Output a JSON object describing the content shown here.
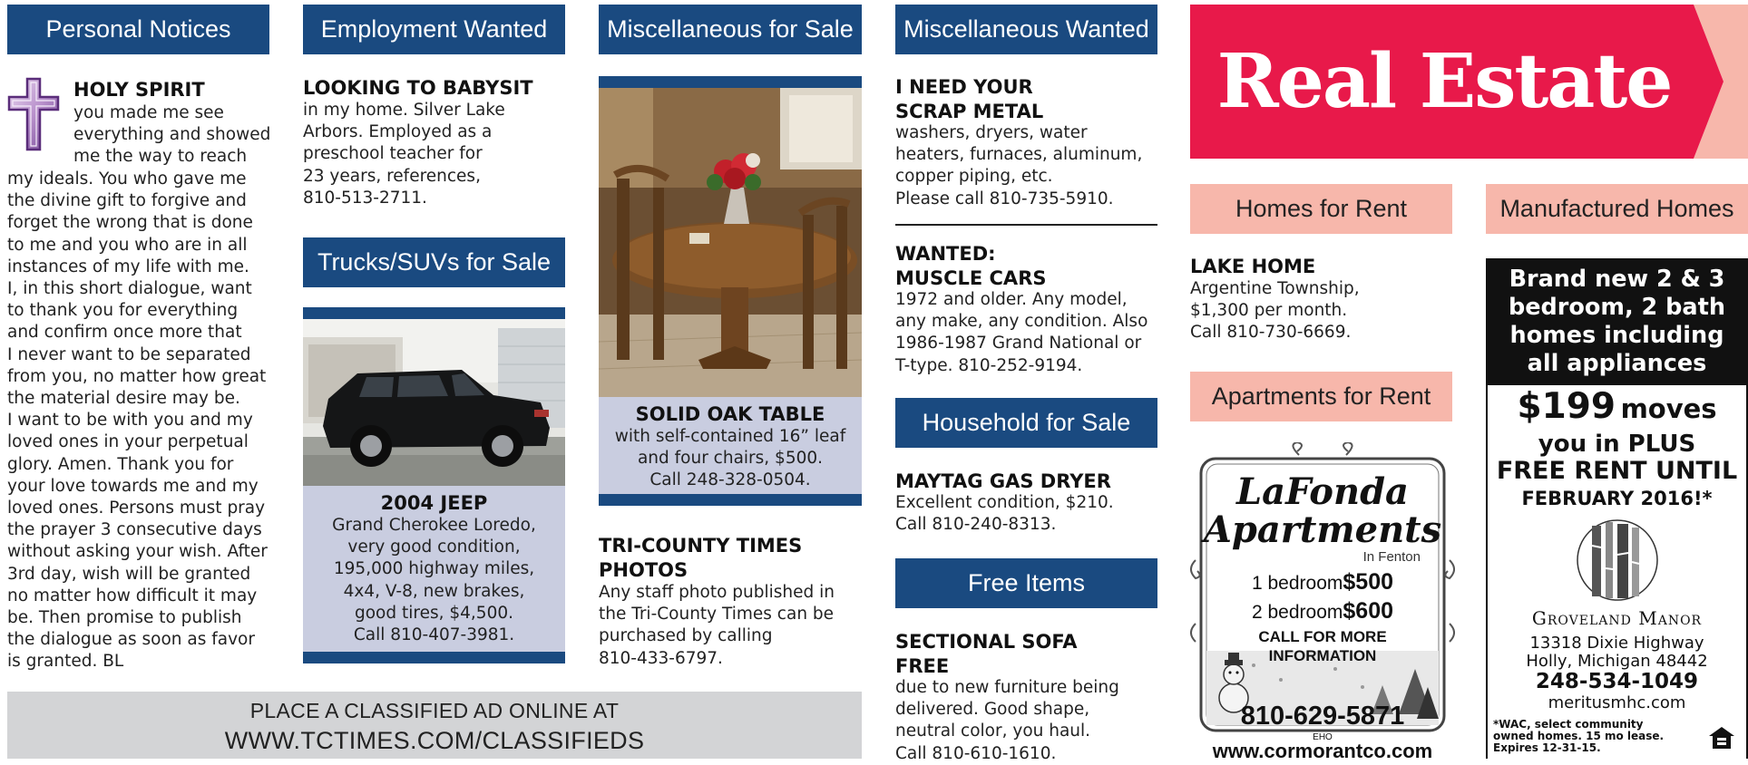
{
  "personal": {
    "header": "Personal Notices",
    "title": "HOLY SPIRIT",
    "lines_indented": [
      "you made me see",
      "everything and showed",
      "me the way to reach"
    ],
    "lines": [
      "my ideals. You who gave me",
      "the divine gift to forgive and",
      "forget the wrong that is done",
      "to me and you who are in all",
      "instances of my life with me.",
      "I, in this short dialogue, want",
      "to thank you for everything",
      "and confirm once more that",
      "I never want to be separated",
      "from you, no matter how great",
      "the material desire may be.",
      "I want to be with you and my",
      "loved ones in your perpetual",
      "glory. Amen. Thank you for",
      "your love towards me and my",
      "loved ones. Persons must pray",
      "the prayer 3 consecutive days",
      "without asking your wish. After",
      "3rd day, wish will be granted",
      "no matter how difficult it may",
      "be. Then promise to publish",
      "the dialogue as soon as favor",
      "is granted. BL"
    ]
  },
  "employment": {
    "header": "Employment Wanted",
    "title": "LOOKING TO BABYSIT",
    "lines": [
      "in my home. Silver Lake",
      "Arbors. Employed as a",
      "preschool teacher for",
      "23 years, references,",
      "810-513-2711."
    ]
  },
  "trucks": {
    "header": "Trucks/SUVs for Sale",
    "title": "2004 JEEP",
    "lines": [
      "Grand Cherokee Loredo,",
      "very good condition,",
      "195,000 highway miles,",
      "4x4, V-8, new brakes,",
      "good tires, $4,500.",
      "Call 810-407-3981."
    ]
  },
  "misc_sale": {
    "header": "Miscellaneous for Sale",
    "title": "SOLID OAK TABLE",
    "lines": [
      "with self-contained 16” leaf",
      "and four chairs, $500.",
      "Call 248-328-0504."
    ],
    "photos_title": [
      "TRI-COUNTY TIMES",
      "PHOTOS"
    ],
    "photos_lines": [
      "Any staff photo published in",
      "the Tri-County Times can be",
      "purchased by calling",
      "810-433-6797."
    ]
  },
  "misc_wanted": {
    "header": "Miscellaneous Wanted",
    "title": [
      "I NEED YOUR",
      "SCRAP METAL"
    ],
    "lines": [
      " washers, dryers, water",
      "heaters, furnaces, aluminum,",
      "copper piping, etc.",
      "Please call 810-735-5910."
    ],
    "title2": [
      "WANTED:",
      "MUSCLE CARS"
    ],
    "lines2": [
      "1972 and older. Any model,",
      "any make, any condition. Also",
      "1986-1987 Grand National or",
      "T-type. 810-252-9194."
    ]
  },
  "household": {
    "header": "Household for Sale",
    "title": "MAYTAG GAS DRYER",
    "lines": [
      "Excellent condition, $210.",
      "Call 810-240-8313."
    ]
  },
  "free": {
    "header": "Free Items",
    "title": [
      "SECTIONAL SOFA",
      "FREE"
    ],
    "lines": [
      "due to new furniture being",
      "delivered. Good shape,",
      "neutral color, you haul.",
      "Call 810-610-1610."
    ]
  },
  "banner": {
    "line1": "PLACE A CLASSIFIED AD ONLINE AT",
    "line2": "WWW.TCTIMES.COM/CLASSIFIEDS"
  },
  "real_estate": {
    "title": "Real Estate",
    "brand_color": "#e8194a",
    "homes_header": "Homes for Rent",
    "homes_title": "LAKE HOME",
    "homes_lines": [
      "Argentine Township,",
      "$1,300 per month.",
      "Call 810-730-6669."
    ],
    "apartments_header": "Apartments for Rent",
    "lafonda": {
      "name1": "LaFonda",
      "name2": "Apartments",
      "location": "In Fenton",
      "bed1_label": "1 bedroom",
      "bed1_price": "$500",
      "bed2_label": "2 bedroom",
      "bed2_price": "$600",
      "call1": "CALL FOR MORE",
      "call2": "INFORMATION",
      "phone": "810-629-5871",
      "eho": "EHO",
      "website": "www.cormorantco.com"
    },
    "manufactured_header": "Manufactured Homes",
    "groveland": {
      "headline": [
        "Brand new 2 & 3",
        "bedroom, 2 bath",
        "homes including",
        "all appliances"
      ],
      "price": "$199",
      "moves": "moves",
      "offer": [
        "you in PLUS",
        "FREE RENT UNTIL",
        "FEBRUARY 2016!*"
      ],
      "name": "Groveland Manor",
      "address": [
        "13318 Dixie Highway",
        "Holly, Michigan 48442"
      ],
      "phone": "248-534-1049",
      "website": "meritusmhc.com",
      "fine_print": [
        "*WAC, select community",
        "owned homes. 15 mo lease.",
        "Expires 12-31-15."
      ]
    }
  },
  "icons": [
    "cross-icon",
    "jeep-photo",
    "oak-table-photo",
    "snowman-illustration",
    "birch-tree-logo",
    "equal-housing-icon",
    "arrow-chevron-icon"
  ]
}
